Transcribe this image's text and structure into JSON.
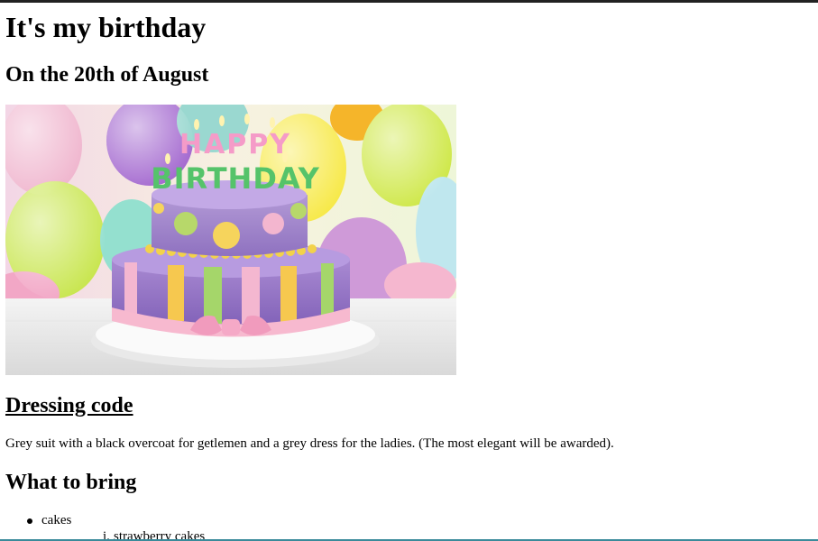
{
  "page": {
    "title": "It's my birthday",
    "date_heading": "On the 20th of August",
    "image_alt": "Birthday cake with Happy Birthday candles",
    "image_candle_text_top": "HAPPY",
    "image_candle_text_bottom": "BIRTHDAY"
  },
  "dressing": {
    "heading": "Dressing code",
    "text": "Grey suit with a black overcoat for getlemen and a grey dress for the ladies. (The most elegant will be awarded)."
  },
  "bring": {
    "heading": "What to bring",
    "items": [
      {
        "label": "cakes",
        "sub_items": [
          {
            "marker": "i.",
            "label": "strawberry cakes"
          }
        ]
      }
    ]
  },
  "colors": {
    "top_bar": "#222222",
    "bottom_bar": "#3a8a9a",
    "text": "#000000",
    "background": "#ffffff"
  }
}
